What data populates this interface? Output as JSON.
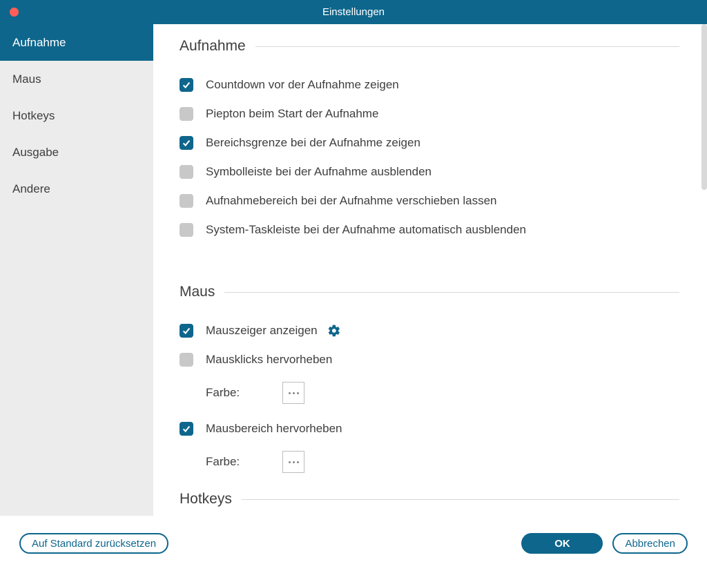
{
  "window": {
    "title": "Einstellungen"
  },
  "sidebar": {
    "items": [
      {
        "label": "Aufnahme",
        "active": true
      },
      {
        "label": "Maus",
        "active": false
      },
      {
        "label": "Hotkeys",
        "active": false
      },
      {
        "label": "Ausgabe",
        "active": false
      },
      {
        "label": "Andere",
        "active": false
      }
    ]
  },
  "sections": {
    "aufnahme": {
      "title": "Aufnahme",
      "checks": [
        {
          "label": "Countdown vor der Aufnahme zeigen",
          "checked": true
        },
        {
          "label": "Piepton beim Start der Aufnahme",
          "checked": false
        },
        {
          "label": "Bereichsgrenze bei der Aufnahme zeigen",
          "checked": true
        },
        {
          "label": "Symbolleiste bei der Aufnahme ausblenden",
          "checked": false
        },
        {
          "label": "Aufnahmebereich bei der Aufnahme verschieben lassen",
          "checked": false
        },
        {
          "label": "System-Taskleiste bei der Aufnahme automatisch ausblenden",
          "checked": false
        }
      ]
    },
    "maus": {
      "title": "Maus",
      "show_cursor": {
        "label": "Mauszeiger anzeigen",
        "checked": true
      },
      "highlight_clicks": {
        "label": "Mausklicks hervorheben",
        "checked": false
      },
      "highlight_area": {
        "label": "Mausbereich hervorheben",
        "checked": true
      },
      "color_label": "Farbe:",
      "click_colors": {
        "swatches": [
          "#e30613",
          "#f7a600",
          "#0a7de3"
        ],
        "selected_index": 1
      },
      "area_colors": {
        "swatches": [
          "#e30613",
          "#f7a600",
          "#0a7de3"
        ],
        "selected_index": 0
      }
    },
    "hotkeys": {
      "title": "Hotkeys"
    }
  },
  "footer": {
    "reset": "Auf Standard zurücksetzen",
    "ok": "OK",
    "cancel": "Abbrechen"
  }
}
